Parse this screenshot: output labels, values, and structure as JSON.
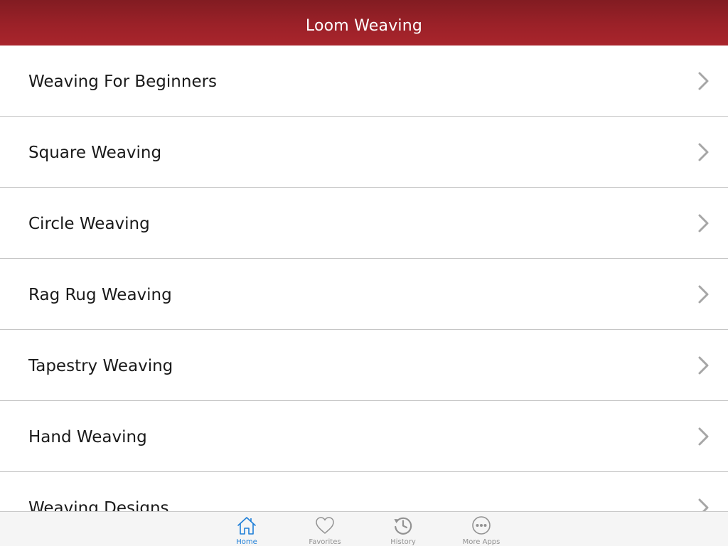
{
  "navbar": {
    "title": "Loom Weaving"
  },
  "list": {
    "items": [
      {
        "label": "Weaving For Beginners"
      },
      {
        "label": "Square Weaving"
      },
      {
        "label": "Circle Weaving"
      },
      {
        "label": "Rag Rug Weaving"
      },
      {
        "label": "Tapestry Weaving"
      },
      {
        "label": "Hand Weaving"
      },
      {
        "label": "Weaving Designs"
      }
    ],
    "chevron_icon": "chevron-right-icon"
  },
  "tabbar": {
    "tabs": [
      {
        "label": "Home",
        "icon": "home-icon",
        "active": true
      },
      {
        "label": "Favorites",
        "icon": "heart-icon",
        "active": false
      },
      {
        "label": "History",
        "icon": "history-icon",
        "active": false
      },
      {
        "label": "More Apps",
        "icon": "more-icon",
        "active": false
      }
    ]
  },
  "colors": {
    "navbar": "#9b2128",
    "tab_active": "#1f7fd8",
    "tab_inactive": "#929292",
    "chevron": "#a6a6a6",
    "separator": "#c6c6c6"
  }
}
